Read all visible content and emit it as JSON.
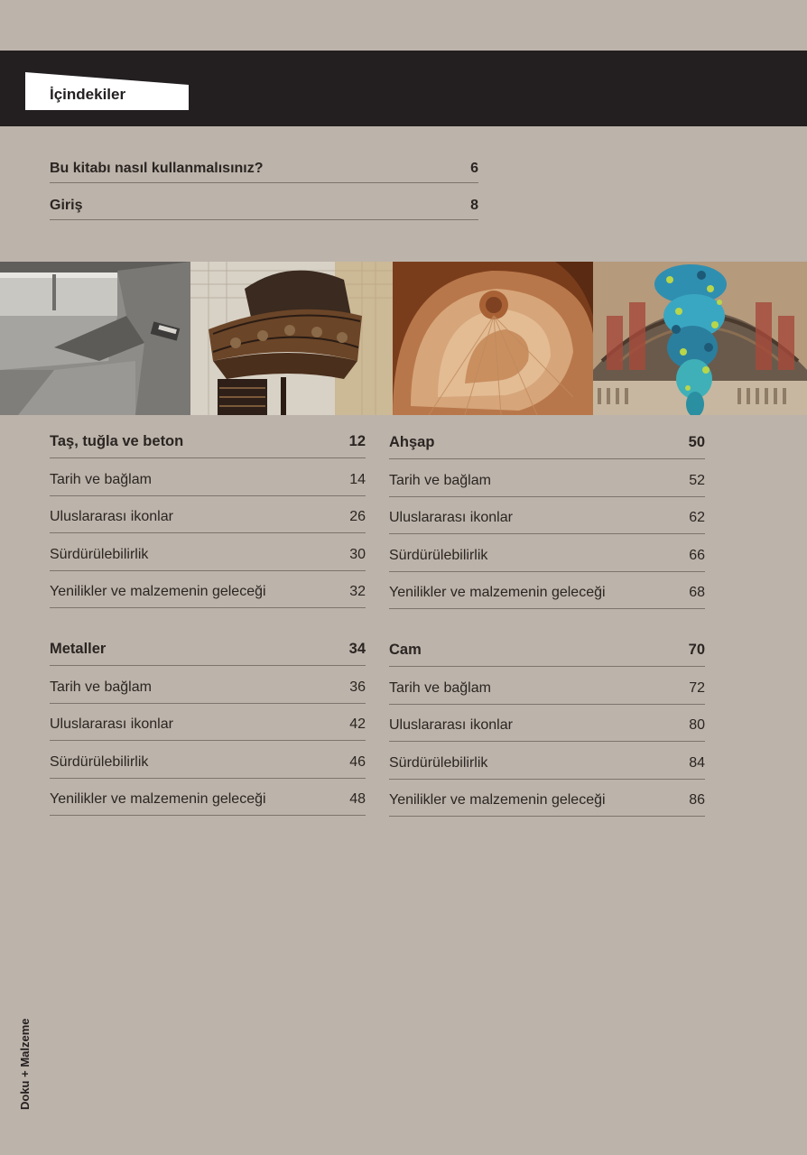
{
  "header": {
    "title": "İçindekiler"
  },
  "intro": [
    {
      "label": "Bu kitabı nasıl kullanmalısınız?",
      "page": "6"
    },
    {
      "label": "Giriş",
      "page": "8"
    }
  ],
  "photos": [
    {
      "icon": "concrete-interior-photo"
    },
    {
      "icon": "spiral-iron-staircase-photo"
    },
    {
      "icon": "wooden-spiral-photo"
    },
    {
      "icon": "glass-chandelier-photo"
    }
  ],
  "sections": [
    {
      "title": "Taş, tuğla ve beton",
      "page": "12",
      "items": [
        {
          "label": "Tarih ve bağlam",
          "page": "14"
        },
        {
          "label": "Uluslararası ikonlar",
          "page": "26"
        },
        {
          "label": "Sürdürülebilirlik",
          "page": "30"
        },
        {
          "label": "Yenilikler ve malzemenin geleceği",
          "page": "32"
        }
      ]
    },
    {
      "title": "Ahşap",
      "page": "50",
      "items": [
        {
          "label": "Tarih ve bağlam",
          "page": "52"
        },
        {
          "label": "Uluslararası ikonlar",
          "page": "62"
        },
        {
          "label": "Sürdürülebilirlik",
          "page": "66"
        },
        {
          "label": "Yenilikler ve malzemenin geleceği",
          "page": "68"
        }
      ]
    },
    {
      "title": "Metaller",
      "page": "34",
      "items": [
        {
          "label": "Tarih ve bağlam",
          "page": "36"
        },
        {
          "label": "Uluslararası ikonlar",
          "page": "42"
        },
        {
          "label": "Sürdürülebilirlik",
          "page": "46"
        },
        {
          "label": "Yenilikler ve malzemenin geleceği",
          "page": "48"
        }
      ]
    },
    {
      "title": "Cam",
      "page": "70",
      "items": [
        {
          "label": "Tarih ve bağlam",
          "page": "72"
        },
        {
          "label": "Uluslararası ikonlar",
          "page": "80"
        },
        {
          "label": "Sürdürülebilirlik",
          "page": "84"
        },
        {
          "label": "Yenilikler ve malzemenin geleceği",
          "page": "86"
        }
      ]
    }
  ],
  "spine": {
    "text": "Doku + Malzeme"
  },
  "colors": {
    "background": "#bcb3aa",
    "band": "#231f20",
    "rule": "#7d746d"
  }
}
